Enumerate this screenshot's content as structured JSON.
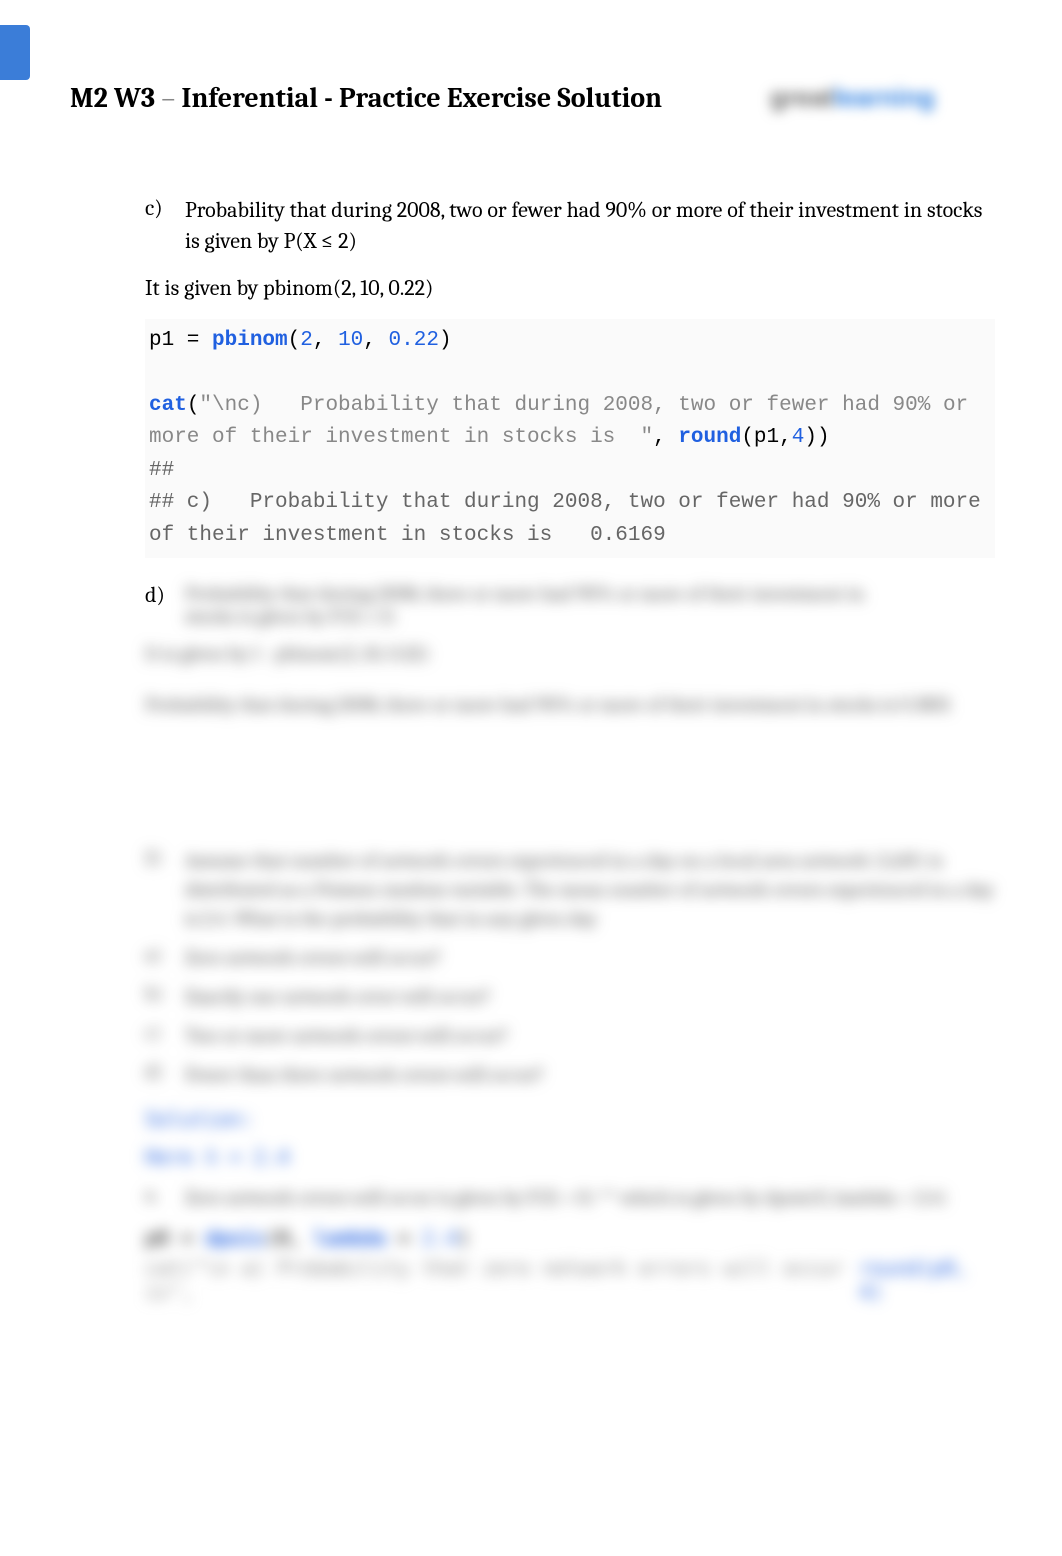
{
  "header": {
    "title_part1": "M2 W3",
    "title_dash": " – ",
    "title_part2": "Inferential - Practice Exercise Solution",
    "logo_text1": "great",
    "logo_text2": "learning"
  },
  "section_c": {
    "label": "c)",
    "text": "Probability that during 2008, two or fewer had 90% or more of their investment in stocks is given by P(X ≤ 2)",
    "given": "It is given by pbinom(2, 10, 0.22)"
  },
  "code1": {
    "lhs": "p1 = ",
    "func": "pbinom",
    "open": "(",
    "n1": "2",
    "c1": ", ",
    "n2": "10",
    "c2": ", ",
    "n3": "0.22",
    "close": ")",
    "blank": "",
    "cat_func": "cat",
    "cat_open": "(",
    "cat_str": "\"\\nc)   Probability that during 2008, two or fewer had 90% or more of their investment in stocks is  \"",
    "cat_c": ", ",
    "round_func": "round",
    "round_open": "(p1,",
    "round_n": "4",
    "round_close": "))",
    "out_hash1": "## ",
    "out_line": "## c)   Probability that during 2008, two or fewer had 90% or more of their investment in stocks is   0.6169"
  },
  "section_d": {
    "label": "d)"
  },
  "blurred": {
    "d_line1": "Probability that during 2008, three or more had 90% or more of their investment in",
    "d_line2": "stocks is given by P(X ≥ 3)",
    "d_given": "It is given by 1 - pbinom(2, 10, 0.22)",
    "d_prob1": "Probability that during 2008, three or more had 90% or more of their investment",
    "d_prob2": "in stocks is 0.3831",
    "q2_label": "2)",
    "q2_body": "Assume that number of network errors experienced in a day on a local area network (LAN) is distributed as a Poisson random variable. The mean number of network errors experienced in a day is 2.4. What is the probability that in any given day",
    "qa_label": "a)",
    "qa_body": "Zero network errors will occur?",
    "qb_label": "b)",
    "qb_body": "Exactly one network error will occur?",
    "qc_label": "c)",
    "qc_body": "Two or more network errors will occur?",
    "qd_label": "d)",
    "qd_body": "Fewer than three network errors will occur?",
    "solution": "Solution:",
    "here": "Here λ = 2.4",
    "ans_a_label": "a.",
    "ans_a_body": "Zero network errors will occur is given by P(X = 0)       ** which is given by dpois(0, lambda = 2.4)",
    "code_lhs": "p0 = ",
    "code_func": "dpois",
    "code_args_open": "(0, ",
    "code_lambda": "lambda",
    "code_eq": " = ",
    "code_val": "2.4",
    "code_close": ")",
    "last_left": "cat(\"\\n a) Probability that zero network errors will occur is\",",
    "last_right": "round(p0, 4)"
  }
}
